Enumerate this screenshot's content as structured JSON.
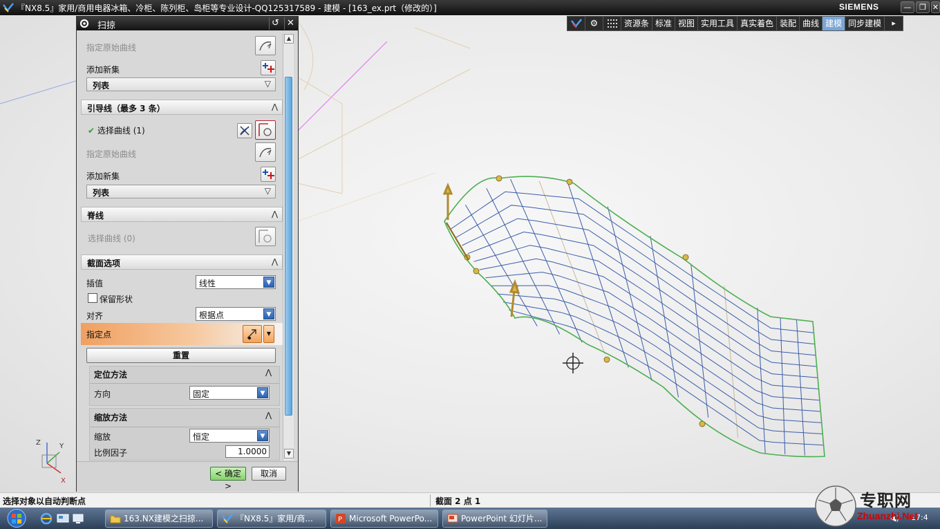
{
  "window": {
    "title": "『NX8.5』家用/商用电器冰箱、冷柜、陈列柜、岛柜等专业设计-QQ125317589 - 建模 - [163_ex.prt（修改的）]",
    "brand": "SIEMENS",
    "controls": {
      "minimize": "—",
      "restore": "❐",
      "close": "✕"
    }
  },
  "toolbar": {
    "tabs": [
      {
        "label": "资源条",
        "active": false
      },
      {
        "label": "标准",
        "active": false
      },
      {
        "label": "视图",
        "active": false
      },
      {
        "label": "实用工具",
        "active": false
      },
      {
        "label": "真实着色",
        "active": false
      },
      {
        "label": "装配",
        "active": false
      },
      {
        "label": "曲线",
        "active": false
      },
      {
        "label": "建模",
        "active": true
      },
      {
        "label": "同步建模",
        "active": false
      }
    ],
    "more": "▸"
  },
  "dialog": {
    "title": "扫掠",
    "sections": {
      "top": {
        "specify_origin_curve": "指定原始曲线",
        "add_new_set": "添加新集",
        "list": "列表"
      },
      "guides": {
        "header": "引导线（最多 3 条）",
        "select_curve": "选择曲线 (1)",
        "specify_origin_curve": "指定原始曲线",
        "add_new_set": "添加新集",
        "list": "列表"
      },
      "spine": {
        "header": "脊线",
        "select_curve": "选择曲线 (0)"
      },
      "section_options": {
        "header": "截面选项",
        "interpolation_label": "插值",
        "interpolation_value": "线性",
        "preserve_shape": "保留形状",
        "preserve_shape_checked": false,
        "alignment_label": "对齐",
        "alignment_value": "根据点",
        "specify_point": "指定点",
        "reset": "重置",
        "orientation": {
          "header": "定位方法",
          "direction_label": "方向",
          "direction_value": "固定"
        },
        "scaling": {
          "header": "缩放方法",
          "scale_label": "缩放",
          "scale_value": "恒定",
          "scale_factor_label": "比例因子",
          "scale_factor_value": "1.0000"
        }
      }
    },
    "footer": {
      "ok": "< 确定 >",
      "cancel": "取消"
    }
  },
  "statusbar": {
    "cue": "选择对象以自动判断点",
    "status": "截面 2 点 1"
  },
  "taskbar": {
    "tasks": [
      {
        "label": "163.NX建模之扫掠...",
        "icon": "folder-icon"
      },
      {
        "label": "『NX8.5』家用/商...",
        "icon": "nx-icon"
      },
      {
        "label": "Microsoft PowerPo...",
        "icon": "powerpoint-icon"
      },
      {
        "label": "PowerPoint 幻灯片...",
        "icon": "slideshow-icon"
      }
    ],
    "clock": "17:4"
  },
  "watermark": {
    "text": "专职网",
    "sub": "Zhuanzhi.Net"
  },
  "triad": {
    "z": "Z",
    "y": "Y",
    "x": "X"
  },
  "colors": {
    "accent_active_tab": "#7aa6d6",
    "surface_edge": "#4caf50",
    "surface_mesh": "#3a5da8",
    "highlight_row": "#f0a060",
    "ok_button": "#87d36d"
  }
}
